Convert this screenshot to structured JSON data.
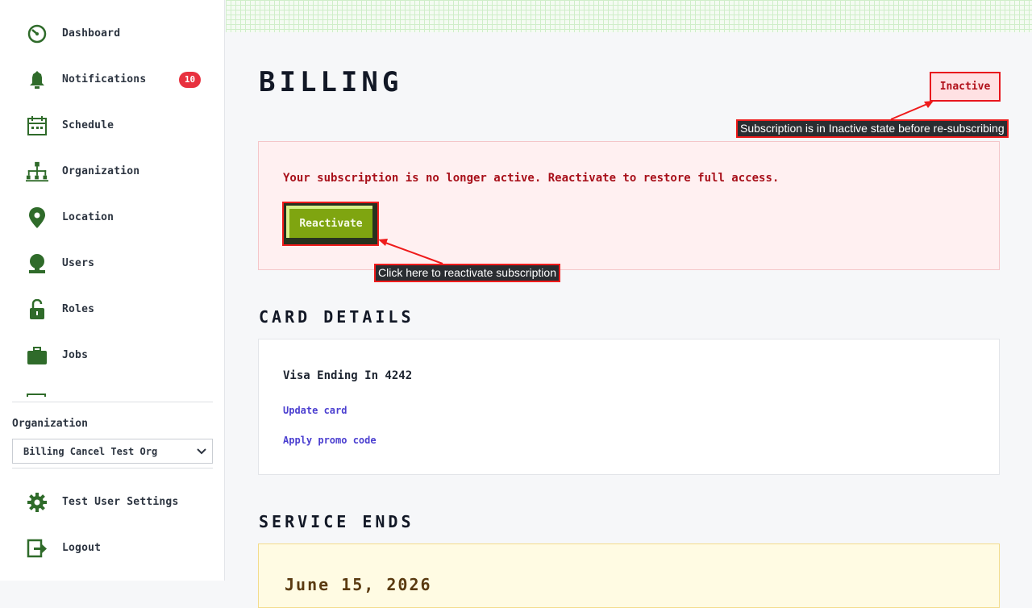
{
  "sidebar": {
    "items": [
      {
        "label": "Dashboard",
        "icon": "dashboard-icon"
      },
      {
        "label": "Notifications",
        "icon": "bell-icon",
        "badge": "10"
      },
      {
        "label": "Schedule",
        "icon": "calendar-icon"
      },
      {
        "label": "Organization",
        "icon": "org-chart-icon"
      },
      {
        "label": "Location",
        "icon": "map-pin-icon"
      },
      {
        "label": "Users",
        "icon": "user-icon"
      },
      {
        "label": "Roles",
        "icon": "lock-icon"
      },
      {
        "label": "Jobs",
        "icon": "briefcase-icon"
      }
    ],
    "organization_label": "Organization",
    "organization_selected": "Billing Cancel Test Org",
    "settings_label": "Test User Settings",
    "logout_label": "Logout"
  },
  "billing": {
    "title": "BILLING",
    "status": "Inactive",
    "status_callout": "Subscription is in Inactive state before re-subscribing",
    "alert_message": "Your subscription is no longer active. Reactivate to restore full access.",
    "reactivate_label": "Reactivate",
    "reactivate_callout": "Click here to reactivate subscription"
  },
  "card_details": {
    "title": "CARD DETAILS",
    "card_label": "Visa Ending In 4242",
    "update_link": "Update card",
    "promo_link": "Apply promo code"
  },
  "service_ends": {
    "title": "SERVICE ENDS",
    "date": "June 15, 2026"
  },
  "colors": {
    "accent_green": "#2f6b2a",
    "reactivate_green": "#7fa510",
    "alert_red": "#a8101a",
    "badge_red": "#e8313f",
    "link_purple": "#4b3fd0",
    "callout_border": "#ef1b1b"
  }
}
